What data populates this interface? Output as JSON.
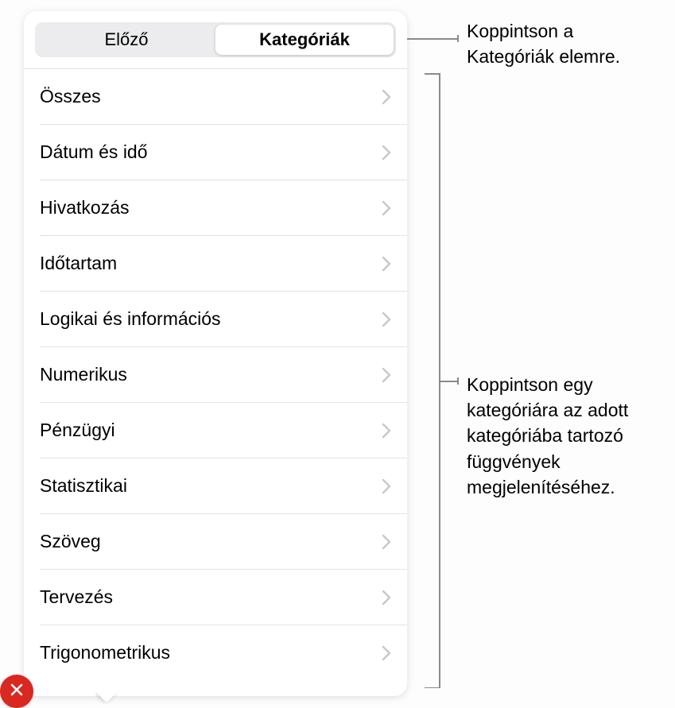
{
  "seg": {
    "prev": "Előző",
    "categories": "Kategóriák"
  },
  "categories": [
    "Összes",
    "Dátum és idő",
    "Hivatkozás",
    "Időtartam",
    "Logikai és információs",
    "Numerikus",
    "Pénzügyi",
    "Statisztikai",
    "Szöveg",
    "Tervezés",
    "Trigonometrikus"
  ],
  "callouts": {
    "tap_categories": "Koppintson a Kategóriák elemre.",
    "tap_category": "Koppintson egy kategóriára az adott kategóriába tartozó függvények megjelenítéséhez."
  },
  "icons": {
    "close": "close"
  }
}
